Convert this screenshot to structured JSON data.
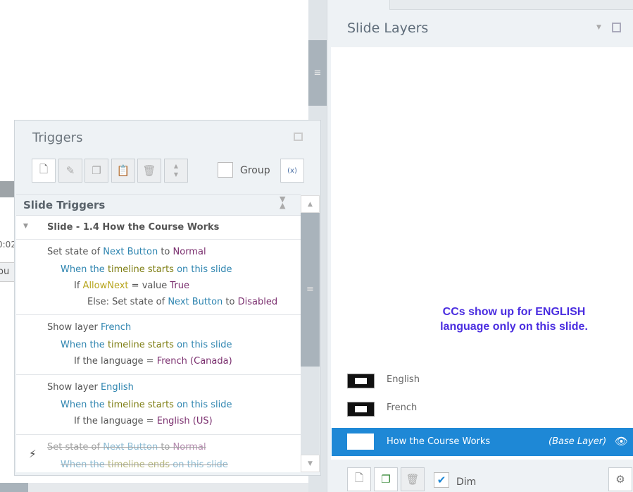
{
  "background": {
    "timecode_fragment": "0:02",
    "label_fragment": "ou"
  },
  "triggers_panel": {
    "title": "Triggers",
    "toolbar": {
      "new": "new-trigger",
      "edit": "edit-trigger",
      "copy": "copy",
      "paste": "paste",
      "delete": "delete",
      "group_label": "Group",
      "group_checked": false
    },
    "section_title": "Slide Triggers",
    "group_title": "Slide - 1.4 How the Course Works",
    "triggers": [
      {
        "action": "Set state of ",
        "object": "Next Button",
        "to": " to ",
        "value": "Normal",
        "when": "When the ",
        "event": "timeline starts",
        "on": " on ",
        "target": "this slide",
        "cond_if": "If ",
        "cond_var": "AllowNext",
        "cond_eq": " = value ",
        "cond_val": "True",
        "else_pre": "Else: Set state of ",
        "else_obj": "Next Button",
        "else_to": " to ",
        "else_val": "Disabled"
      },
      {
        "action": "Show layer ",
        "object": "French",
        "when": "When the ",
        "event": "timeline starts",
        "on": " on ",
        "target": "this slide",
        "cond": "If the language = ",
        "cond_val": "French (Canada)"
      },
      {
        "action": "Show layer ",
        "object": "English",
        "when": "When the ",
        "event": "timeline starts",
        "on": " on ",
        "target": "this slide",
        "cond": "If the language = ",
        "cond_val": "English (US)"
      },
      {
        "action": "Set state of ",
        "object": "Next Button",
        "to": " to ",
        "value": "Normal",
        "when": "When the ",
        "event": "timeline ends",
        "on": " on ",
        "target": "this slide",
        "disabled": true
      }
    ]
  },
  "layers_panel": {
    "title": "Slide Layers",
    "note": "CCs show up for ENGLISH language only on this slide.",
    "layers": [
      {
        "name": "English"
      },
      {
        "name": "French"
      }
    ],
    "base_layer": {
      "name": "How the Course Works",
      "tag": "(Base Layer)"
    },
    "dim_label": "Dim",
    "dim_checked": true
  },
  "colors": {
    "accent": "#1e88d6",
    "note": "#4a2de0"
  }
}
